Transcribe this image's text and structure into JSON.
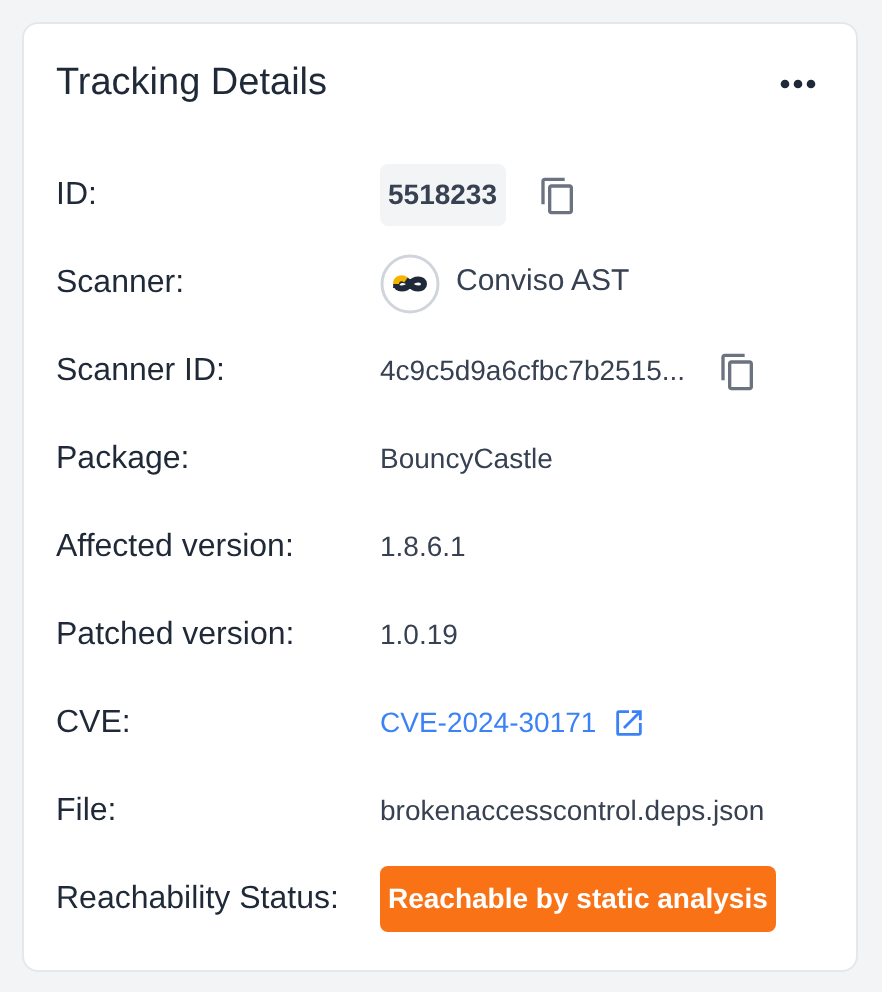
{
  "card": {
    "title": "Tracking Details"
  },
  "rows": [
    {
      "kind": "id",
      "label": "ID:",
      "value": "5518233"
    },
    {
      "kind": "scanner",
      "label": "Scanner:",
      "value": "Conviso AST"
    },
    {
      "kind": "copy",
      "label": "Scanner ID:",
      "value": "4c9c5d9a6cfbc7b2515..."
    },
    {
      "kind": "text",
      "label": "Package:",
      "value": "BouncyCastle"
    },
    {
      "kind": "text",
      "label": "Affected version:",
      "value": "1.8.6.1"
    },
    {
      "kind": "text",
      "label": "Patched version:",
      "value": "1.0.19"
    },
    {
      "kind": "link",
      "label": "CVE:",
      "value": "CVE-2024-30171"
    },
    {
      "kind": "text",
      "label": "File:",
      "value": "brokenaccesscontrol.deps.json"
    },
    {
      "kind": "status",
      "label": "Reachability Status:",
      "value": "Reachable by static analysis"
    }
  ]
}
